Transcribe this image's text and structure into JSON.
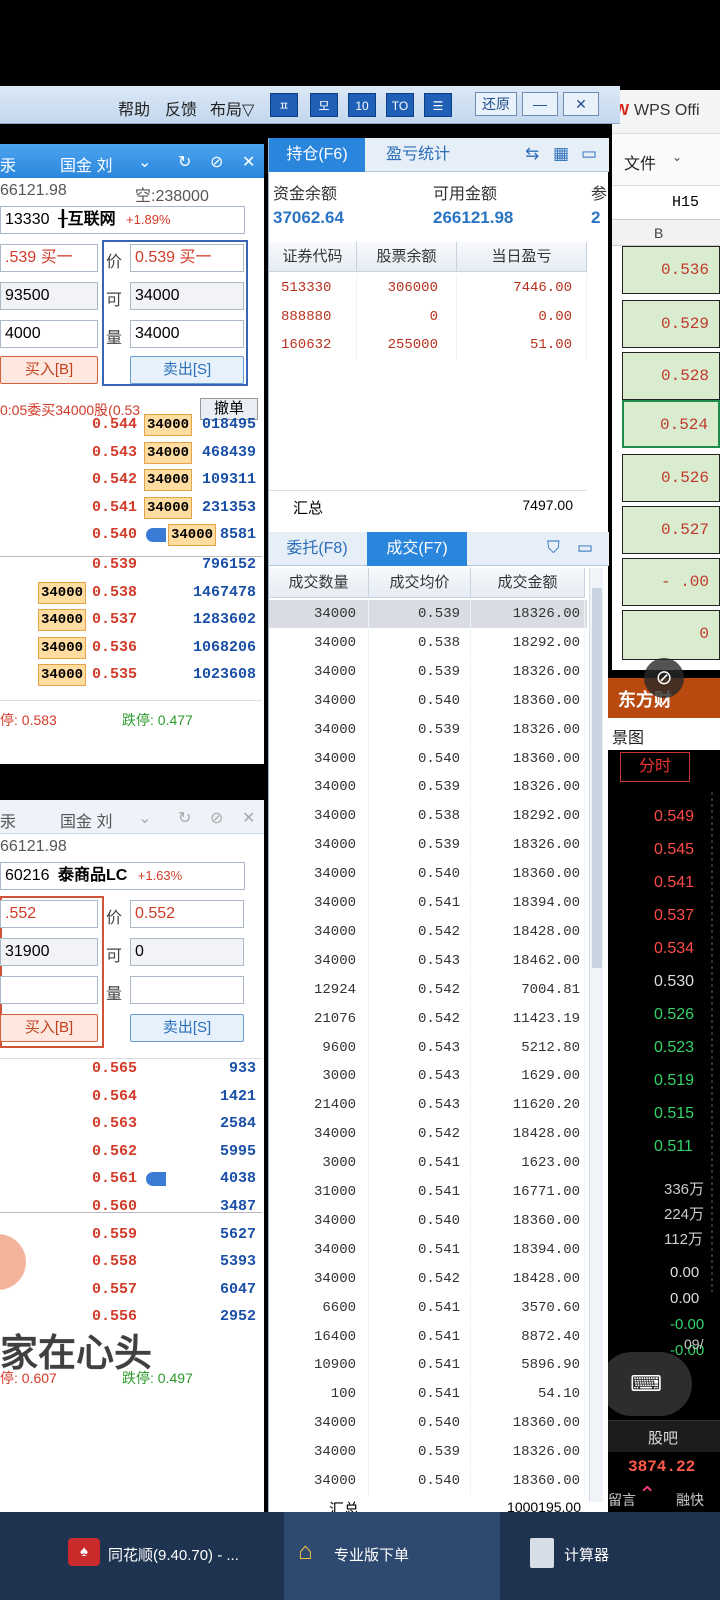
{
  "toolbar": {
    "help": "帮助",
    "feedback": "反馈",
    "layout": "布局▽",
    "btn1": "ㅍ",
    "btn2": "모",
    "btn3": "10",
    "btn4": "TO",
    "btn5": "☰",
    "restore": "还原",
    "minimize": "—",
    "close": "✕"
  },
  "wps": {
    "title": "WPS Offi",
    "menu": "文件",
    "cell_ref": "H15",
    "col": "B",
    "cells": [
      "0.536",
      "0.529",
      "0.528",
      "0.524",
      "0.526",
      "0.527",
      "- .00",
      "0"
    ]
  },
  "panel1": {
    "tab_label": "国金 刘",
    "fund_left": "66121.98",
    "fund_right": "空:238000",
    "code": "13330",
    "stock_name": "╂互联网",
    "change": "+1.89%",
    "price_left": ".539 买一",
    "price_label": "价",
    "price": "0.539 买一",
    "avail_left": "93500",
    "avail_label": "可",
    "avail": "34000",
    "qty_left": "4000",
    "qty_label": "量",
    "qty": "34000",
    "buy": "买入[B]",
    "sell": "卖出[S]",
    "msg": "0:05委买34000股(0.53",
    "cancel": "撤单",
    "sell_quotes": [
      {
        "price": "0.544",
        "mine": "34000",
        "vol": "018495"
      },
      {
        "price": "0.543",
        "mine": "34000",
        "vol": "468439"
      },
      {
        "price": "0.542",
        "mine": "34000",
        "vol": "109311"
      },
      {
        "price": "0.541",
        "mine": "34000",
        "vol": "231353"
      },
      {
        "price": "0.540",
        "mine": "34000",
        "vol": "8581"
      }
    ],
    "buy_quotes": [
      {
        "price": "0.539",
        "mine": "",
        "vol": "796152"
      },
      {
        "price": "0.538",
        "mine": "34000",
        "vol": "1467478"
      },
      {
        "price": "0.537",
        "mine": "34000",
        "vol": "1283602"
      },
      {
        "price": "0.536",
        "mine": "34000",
        "vol": "1068206"
      },
      {
        "price": "0.535",
        "mine": "34000",
        "vol": "1023608"
      }
    ],
    "limit_up": "停: 0.583",
    "limit_down": "跌停: 0.477"
  },
  "panel2": {
    "tab_label": "国金 刘",
    "fund_left": "66121.98",
    "code": "60216",
    "stock_name": "泰商品LC",
    "change": "+1.63%",
    "price_left": ".552",
    "price_label": "价",
    "price": "0.552",
    "avail_left": "31900",
    "avail_label": "可",
    "avail": "0",
    "qty_left": "",
    "qty_label": "量",
    "qty": "",
    "buy": "买入[B]",
    "sell": "卖出[S]",
    "sell_quotes": [
      {
        "price": "0.565",
        "vol": "933"
      },
      {
        "price": "0.564",
        "vol": "1421"
      },
      {
        "price": "0.563",
        "vol": "2584"
      },
      {
        "price": "0.562",
        "vol": "5995"
      },
      {
        "price": "0.561",
        "vol": "4038"
      }
    ],
    "buy_quotes": [
      {
        "price": "0.560",
        "vol": "3487"
      },
      {
        "price": "0.559",
        "vol": "5627"
      },
      {
        "price": "0.558",
        "vol": "5393"
      },
      {
        "price": "0.557",
        "vol": "6047"
      },
      {
        "price": "0.556",
        "vol": "2952"
      }
    ],
    "limit_up": "停: 0.607",
    "limit_down": "跌停: 0.497",
    "watermark": "家在心头"
  },
  "positions": {
    "tab_active": "持仓(F6)",
    "tab2": "盈亏统计",
    "fund_label": "资金余额",
    "fund_value": "37062.64",
    "avail_label": "可用金额",
    "avail_value": "266121.98",
    "extra_label": "参",
    "extra_value": "2",
    "headers": [
      "证券代码",
      "股票余额",
      "当日盈亏"
    ],
    "rows": [
      {
        "code": "513330",
        "qty": "306000",
        "pl": "7446.00"
      },
      {
        "code": "888880",
        "qty": "0",
        "pl": "0.00"
      },
      {
        "code": "160632",
        "qty": "255000",
        "pl": "51.00"
      }
    ],
    "total_label": "汇总",
    "total": "7497.00"
  },
  "deals": {
    "tab1": "委托(F8)",
    "tab_active": "成交(F7)",
    "headers": [
      "成交数量",
      "成交均价",
      "成交金额"
    ],
    "rows": [
      [
        "34000",
        "0.539",
        "18326.00"
      ],
      [
        "34000",
        "0.538",
        "18292.00"
      ],
      [
        "34000",
        "0.539",
        "18326.00"
      ],
      [
        "34000",
        "0.540",
        "18360.00"
      ],
      [
        "34000",
        "0.539",
        "18326.00"
      ],
      [
        "34000",
        "0.540",
        "18360.00"
      ],
      [
        "34000",
        "0.539",
        "18326.00"
      ],
      [
        "34000",
        "0.538",
        "18292.00"
      ],
      [
        "34000",
        "0.539",
        "18326.00"
      ],
      [
        "34000",
        "0.540",
        "18360.00"
      ],
      [
        "34000",
        "0.541",
        "18394.00"
      ],
      [
        "34000",
        "0.542",
        "18428.00"
      ],
      [
        "34000",
        "0.543",
        "18462.00"
      ],
      [
        "12924",
        "0.542",
        "7004.81"
      ],
      [
        "21076",
        "0.542",
        "11423.19"
      ],
      [
        "9600",
        "0.543",
        "5212.80"
      ],
      [
        "3000",
        "0.543",
        "1629.00"
      ],
      [
        "21400",
        "0.543",
        "11620.20"
      ],
      [
        "34000",
        "0.542",
        "18428.00"
      ],
      [
        "3000",
        "0.541",
        "1623.00"
      ],
      [
        "31000",
        "0.541",
        "16771.00"
      ],
      [
        "34000",
        "0.540",
        "18360.00"
      ],
      [
        "34000",
        "0.541",
        "18394.00"
      ],
      [
        "34000",
        "0.542",
        "18428.00"
      ],
      [
        "6600",
        "0.541",
        "3570.60"
      ],
      [
        "16400",
        "0.541",
        "8872.40"
      ],
      [
        "10900",
        "0.541",
        "5896.90"
      ],
      [
        "100",
        "0.541",
        "54.10"
      ],
      [
        "34000",
        "0.540",
        "18360.00"
      ],
      [
        "34000",
        "0.539",
        "18326.00"
      ],
      [
        "34000",
        "0.540",
        "18360.00"
      ]
    ],
    "total_label": "汇总",
    "total": "1000195.00"
  },
  "ths": {
    "banner": "东方财",
    "tab_left": "景图",
    "tab": "分时",
    "prices": [
      "0.549",
      "0.545",
      "0.541",
      "0.537",
      "0.534",
      "0.530",
      "0.526",
      "0.523",
      "0.519",
      "0.515",
      "0.511"
    ],
    "vols": [
      "336万",
      "224万",
      "112万"
    ],
    "changes": [
      "0.00",
      "0.00",
      "-0.00",
      "-0.00"
    ],
    "date": "09/",
    "guba": "股吧",
    "index": "3874.22",
    "bottom": "留言",
    "bottom2": "融快"
  },
  "taskbar": {
    "app1": "同花顺(9.40.70) - ...",
    "app2": "专业版下单",
    "app3": "计算器"
  }
}
